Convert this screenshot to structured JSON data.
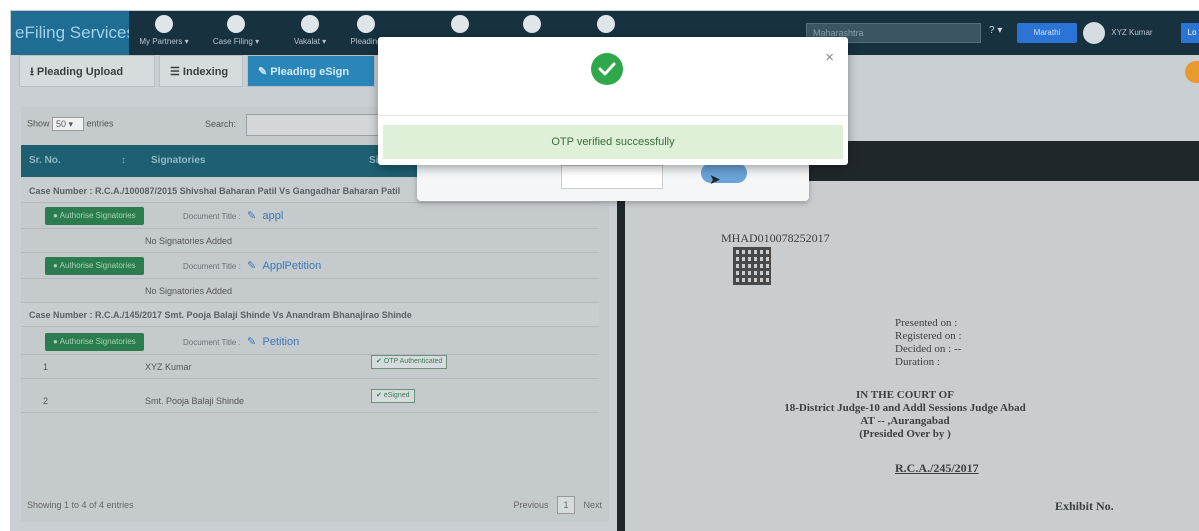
{
  "navbar": {
    "brand": "eFiling Services",
    "menu": [
      "My Partners ▾",
      "Case Filing ▾",
      "Vakalat ▾",
      "Pleading"
    ],
    "search_value": "Maharashtra",
    "help": "? ▾",
    "language_button": "Marathi",
    "user_name": "XYZ Kumar",
    "logout": "Lo"
  },
  "tabs": {
    "pleading_upload": "⭳ Pleading Upload",
    "indexing": "☰ Indexing",
    "pleading_esign": "✎ Pleading eSign"
  },
  "table": {
    "show_label_prefix": "Show",
    "show_value": "50 ▾",
    "show_label_suffix": "entries",
    "search_label": "Search:",
    "headers": {
      "sr_no": "Sr. No.",
      "signatories": "Signatories",
      "signature_type": "Signature Type"
    },
    "case1": {
      "title": "Case Number : R.C.A./100087/2015 Shivshal Baharan Patil Vs Gangadhar Baharan Patil",
      "doc1_title": "appl",
      "doc2_title": "ApplPetition",
      "no_signatories": "No Signatories Added"
    },
    "case2": {
      "title": "Case Number : R.C.A./145/2017 Smt. Pooja Balaji Shinde Vs Anandram Bhanajirao Shinde",
      "doc_title": "Petition",
      "rows": [
        {
          "sr": "1",
          "name": "XYZ Kumar",
          "status": "✔ OTP Authenticated"
        },
        {
          "sr": "2",
          "name": "Smt. Pooja Balaji Shinde",
          "status": "✔ eSigned"
        }
      ]
    },
    "authorise_label": "● Authorise Signatories",
    "document_title_label": "Document Title :",
    "showing": "Showing 1 to 4 of 4 entries",
    "previous": "Previous",
    "page": "1",
    "next": "Next"
  },
  "document": {
    "number": "MHAD010078252017",
    "presented_on": "Presented on   :",
    "registered_on": "Registered on :",
    "decided_on": "Decided on     : --",
    "duration": "Duration        :",
    "court_line1": "IN THE COURT OF",
    "court_line2": "18-District Judge-10 and Addl Sessions Judge Abad",
    "court_line3": "AT -- ,Aurangabad",
    "court_line4": "(Presided Over by )",
    "case_no": "R.C.A./245/2017",
    "exhibit": "Exhibit No."
  },
  "modal": {
    "message": "OTP verified successfully",
    "close": "×"
  }
}
